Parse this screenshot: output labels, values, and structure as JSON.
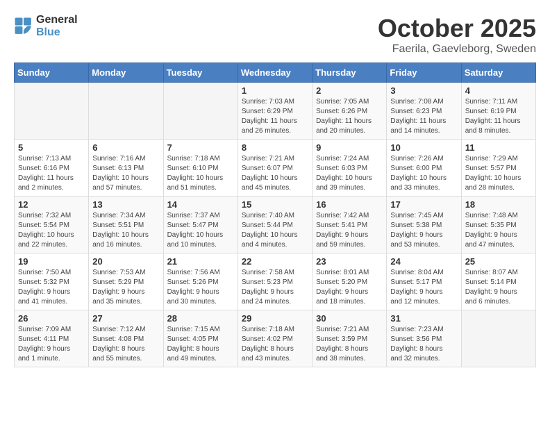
{
  "header": {
    "logo_line1": "General",
    "logo_line2": "Blue",
    "month": "October 2025",
    "location": "Faerila, Gaevleborg, Sweden"
  },
  "weekdays": [
    "Sunday",
    "Monday",
    "Tuesday",
    "Wednesday",
    "Thursday",
    "Friday",
    "Saturday"
  ],
  "weeks": [
    [
      {
        "day": "",
        "info": ""
      },
      {
        "day": "",
        "info": ""
      },
      {
        "day": "",
        "info": ""
      },
      {
        "day": "1",
        "info": "Sunrise: 7:03 AM\nSunset: 6:29 PM\nDaylight: 11 hours\nand 26 minutes."
      },
      {
        "day": "2",
        "info": "Sunrise: 7:05 AM\nSunset: 6:26 PM\nDaylight: 11 hours\nand 20 minutes."
      },
      {
        "day": "3",
        "info": "Sunrise: 7:08 AM\nSunset: 6:23 PM\nDaylight: 11 hours\nand 14 minutes."
      },
      {
        "day": "4",
        "info": "Sunrise: 7:11 AM\nSunset: 6:19 PM\nDaylight: 11 hours\nand 8 minutes."
      }
    ],
    [
      {
        "day": "5",
        "info": "Sunrise: 7:13 AM\nSunset: 6:16 PM\nDaylight: 11 hours\nand 2 minutes."
      },
      {
        "day": "6",
        "info": "Sunrise: 7:16 AM\nSunset: 6:13 PM\nDaylight: 10 hours\nand 57 minutes."
      },
      {
        "day": "7",
        "info": "Sunrise: 7:18 AM\nSunset: 6:10 PM\nDaylight: 10 hours\nand 51 minutes."
      },
      {
        "day": "8",
        "info": "Sunrise: 7:21 AM\nSunset: 6:07 PM\nDaylight: 10 hours\nand 45 minutes."
      },
      {
        "day": "9",
        "info": "Sunrise: 7:24 AM\nSunset: 6:03 PM\nDaylight: 10 hours\nand 39 minutes."
      },
      {
        "day": "10",
        "info": "Sunrise: 7:26 AM\nSunset: 6:00 PM\nDaylight: 10 hours\nand 33 minutes."
      },
      {
        "day": "11",
        "info": "Sunrise: 7:29 AM\nSunset: 5:57 PM\nDaylight: 10 hours\nand 28 minutes."
      }
    ],
    [
      {
        "day": "12",
        "info": "Sunrise: 7:32 AM\nSunset: 5:54 PM\nDaylight: 10 hours\nand 22 minutes."
      },
      {
        "day": "13",
        "info": "Sunrise: 7:34 AM\nSunset: 5:51 PM\nDaylight: 10 hours\nand 16 minutes."
      },
      {
        "day": "14",
        "info": "Sunrise: 7:37 AM\nSunset: 5:47 PM\nDaylight: 10 hours\nand 10 minutes."
      },
      {
        "day": "15",
        "info": "Sunrise: 7:40 AM\nSunset: 5:44 PM\nDaylight: 10 hours\nand 4 minutes."
      },
      {
        "day": "16",
        "info": "Sunrise: 7:42 AM\nSunset: 5:41 PM\nDaylight: 9 hours\nand 59 minutes."
      },
      {
        "day": "17",
        "info": "Sunrise: 7:45 AM\nSunset: 5:38 PM\nDaylight: 9 hours\nand 53 minutes."
      },
      {
        "day": "18",
        "info": "Sunrise: 7:48 AM\nSunset: 5:35 PM\nDaylight: 9 hours\nand 47 minutes."
      }
    ],
    [
      {
        "day": "19",
        "info": "Sunrise: 7:50 AM\nSunset: 5:32 PM\nDaylight: 9 hours\nand 41 minutes."
      },
      {
        "day": "20",
        "info": "Sunrise: 7:53 AM\nSunset: 5:29 PM\nDaylight: 9 hours\nand 35 minutes."
      },
      {
        "day": "21",
        "info": "Sunrise: 7:56 AM\nSunset: 5:26 PM\nDaylight: 9 hours\nand 30 minutes."
      },
      {
        "day": "22",
        "info": "Sunrise: 7:58 AM\nSunset: 5:23 PM\nDaylight: 9 hours\nand 24 minutes."
      },
      {
        "day": "23",
        "info": "Sunrise: 8:01 AM\nSunset: 5:20 PM\nDaylight: 9 hours\nand 18 minutes."
      },
      {
        "day": "24",
        "info": "Sunrise: 8:04 AM\nSunset: 5:17 PM\nDaylight: 9 hours\nand 12 minutes."
      },
      {
        "day": "25",
        "info": "Sunrise: 8:07 AM\nSunset: 5:14 PM\nDaylight: 9 hours\nand 6 minutes."
      }
    ],
    [
      {
        "day": "26",
        "info": "Sunrise: 7:09 AM\nSunset: 4:11 PM\nDaylight: 9 hours\nand 1 minute."
      },
      {
        "day": "27",
        "info": "Sunrise: 7:12 AM\nSunset: 4:08 PM\nDaylight: 8 hours\nand 55 minutes."
      },
      {
        "day": "28",
        "info": "Sunrise: 7:15 AM\nSunset: 4:05 PM\nDaylight: 8 hours\nand 49 minutes."
      },
      {
        "day": "29",
        "info": "Sunrise: 7:18 AM\nSunset: 4:02 PM\nDaylight: 8 hours\nand 43 minutes."
      },
      {
        "day": "30",
        "info": "Sunrise: 7:21 AM\nSunset: 3:59 PM\nDaylight: 8 hours\nand 38 minutes."
      },
      {
        "day": "31",
        "info": "Sunrise: 7:23 AM\nSunset: 3:56 PM\nDaylight: 8 hours\nand 32 minutes."
      },
      {
        "day": "",
        "info": ""
      }
    ]
  ]
}
